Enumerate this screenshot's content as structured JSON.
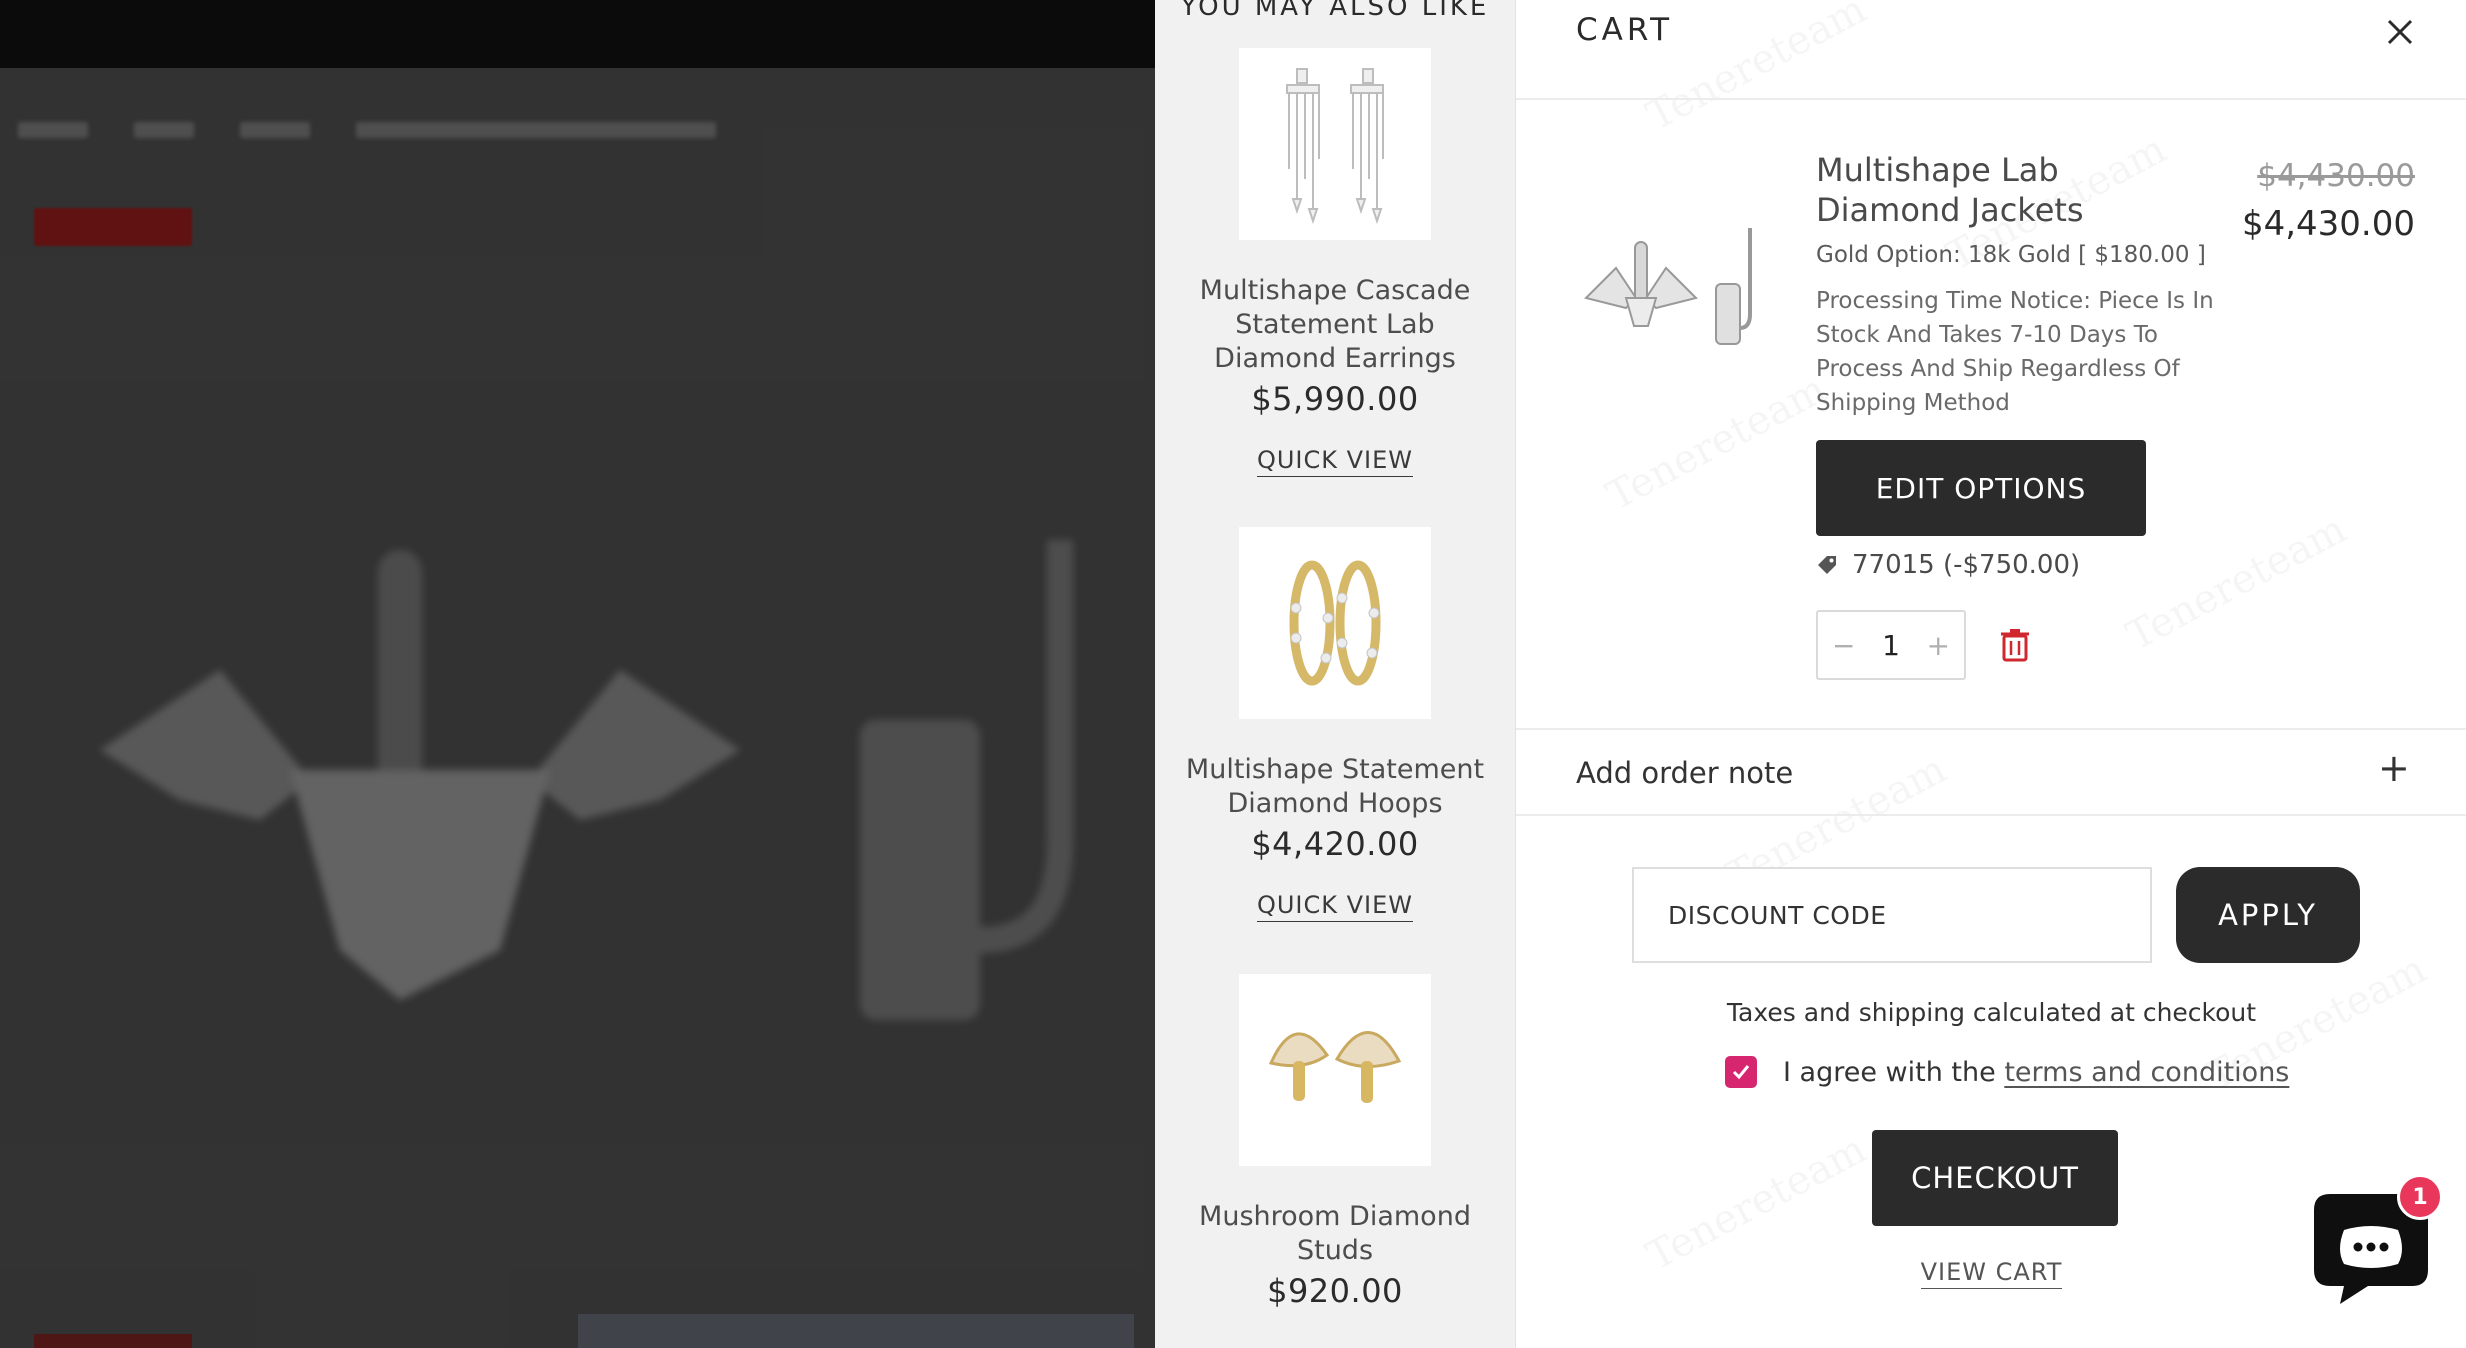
{
  "upsell": {
    "title": "YOU MAY ALSO LIKE",
    "items": [
      {
        "name": "Multishape Cascade Statement Lab Diamond Earrings",
        "price": "$5,990.00",
        "quick_view": "QUICK VIEW",
        "icon": "earring-cascade-icon"
      },
      {
        "name": "Multishape Statement Diamond Hoops",
        "price": "$4,420.00",
        "quick_view": "QUICK VIEW",
        "icon": "hoop-earring-icon"
      },
      {
        "name": "Mushroom Diamond Studs",
        "price": "$920.00",
        "icon": "mushroom-stud-icon"
      }
    ]
  },
  "cart": {
    "title": "CART",
    "item": {
      "name": "Multishape Lab Diamond Jackets",
      "variant": "Gold Option: 18k Gold [ $180.00 ]",
      "notice": "Processing Time Notice: Piece Is In Stock And Takes 7-10 Days To Process And Ship Regardless Of Shipping Method",
      "compare_price": "$4,430.00",
      "price": "$4,430.00",
      "edit_label": "EDIT OPTIONS",
      "discount": "77015 (-$750.00)",
      "quantity": "1",
      "minus": "−",
      "plus": "+"
    },
    "order_note": {
      "label": "Add order note",
      "icon": "+"
    },
    "discount_placeholder": "DISCOUNT CODE",
    "apply_label": "APPLY",
    "tax_note": "Taxes and shipping calculated at checkout",
    "terms_prefix": "I agree with the",
    "terms_link": "terms and conditions",
    "checkout_label": "CHECKOUT",
    "view_cart_label": "VIEW CART"
  },
  "chat": {
    "badge": "1"
  },
  "watermark": "Tenereteam",
  "colors": {
    "accent_button": "#2b2b2b",
    "checkbox": "#d6266f",
    "badge": "#e8375a",
    "remove_icon": "#d0262e"
  }
}
